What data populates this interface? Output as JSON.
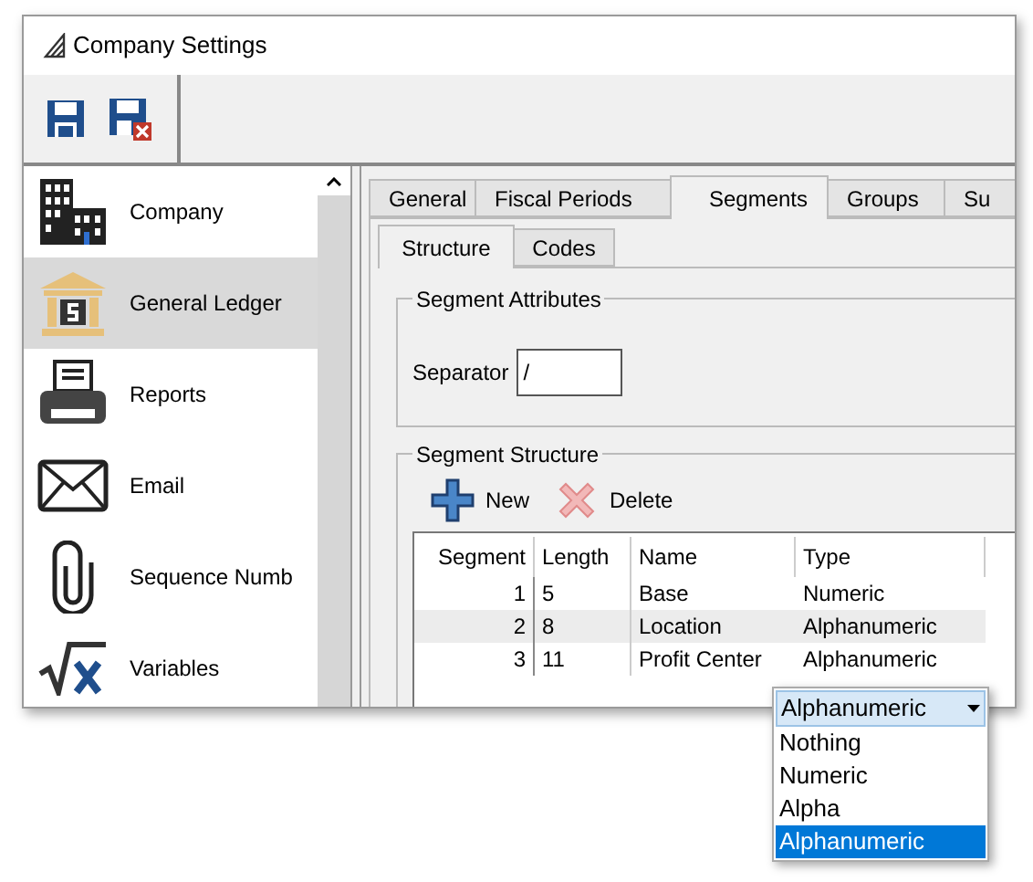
{
  "window": {
    "title": "Company Settings"
  },
  "sidebar": {
    "items": [
      {
        "label": "Company",
        "selected": false
      },
      {
        "label": "General Ledger",
        "selected": true
      },
      {
        "label": "Reports",
        "selected": false
      },
      {
        "label": "Email",
        "selected": false
      },
      {
        "label": "Sequence Numb",
        "selected": false
      },
      {
        "label": "Variables",
        "selected": false
      }
    ]
  },
  "tabs": [
    {
      "label": "General",
      "selected": false
    },
    {
      "label": "Fiscal Periods",
      "selected": false
    },
    {
      "label": "Segments",
      "selected": true
    },
    {
      "label": "Groups",
      "selected": false
    },
    {
      "label": "Su",
      "selected": false
    }
  ],
  "subtabs": [
    {
      "label": "Structure",
      "selected": true
    },
    {
      "label": "Codes",
      "selected": false
    }
  ],
  "segment_attributes": {
    "title": "Segment Attributes",
    "separator_label": "Separator",
    "separator_value": "/"
  },
  "segment_structure": {
    "title": "Segment Structure",
    "actions": [
      {
        "kind": "new",
        "label": "New"
      },
      {
        "kind": "delete",
        "label": "Delete"
      }
    ],
    "table": {
      "columns": [
        "Segment",
        "Length",
        "Name",
        "Type"
      ],
      "rows": [
        {
          "cells": [
            "1",
            "5",
            "Base",
            "Numeric"
          ],
          "selected": false
        },
        {
          "cells": [
            "2",
            "8",
            "Location",
            "Alphanumeric"
          ],
          "selected": true
        },
        {
          "cells": [
            "3",
            "11",
            "Profit Center",
            "Alphanumeric"
          ],
          "selected": false
        }
      ]
    }
  },
  "dropdown": {
    "value": "Alphanumeric",
    "options": [
      {
        "label": "Nothing",
        "selected": false
      },
      {
        "label": "Numeric",
        "selected": false
      },
      {
        "label": "Alpha",
        "selected": false
      },
      {
        "label": "Alphanumeric",
        "selected": true
      }
    ]
  }
}
